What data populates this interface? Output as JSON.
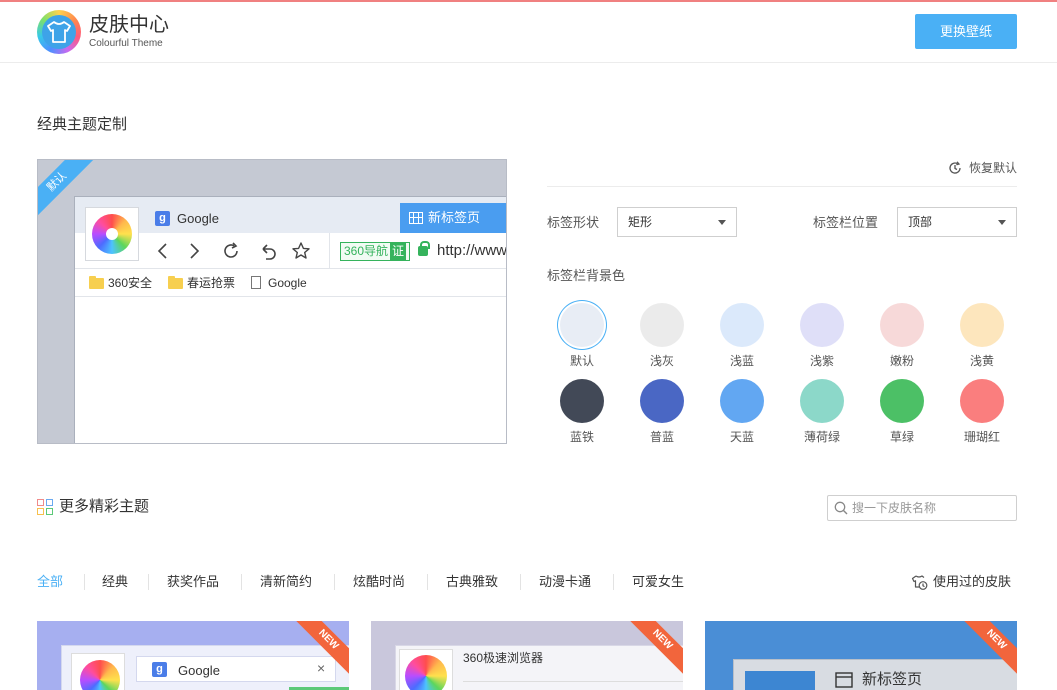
{
  "header": {
    "title": "皮肤中心",
    "subtitle": "Colourful Theme",
    "wallpaper_button": "更换壁纸"
  },
  "classic": {
    "section_title": "经典主题定制",
    "preview": {
      "ribbon": "默认",
      "tab_google": "Google",
      "tab_newtab": "新标签页",
      "badge_text": "360导航",
      "badge_cert": "证",
      "url": "http://www",
      "bookmarks": [
        "360安全",
        "春运抢票",
        "Google"
      ]
    },
    "restore_label": "恢复默认",
    "tab_shape_label": "标签形状",
    "tab_shape_value": "矩形",
    "tabbar_position_label": "标签栏位置",
    "tabbar_position_value": "顶部",
    "bg_color_label": "标签栏背景色",
    "colors": [
      {
        "name": "默认",
        "color": "#e8edf5",
        "selected": true
      },
      {
        "name": "浅灰",
        "color": "#ebebeb"
      },
      {
        "name": "浅蓝",
        "color": "#dbe9fb"
      },
      {
        "name": "浅紫",
        "color": "#dfdff8"
      },
      {
        "name": "嫩粉",
        "color": "#f7d9d9"
      },
      {
        "name": "浅黄",
        "color": "#fde6bd"
      },
      {
        "name": "蓝铁",
        "color": "#424957"
      },
      {
        "name": "普蓝",
        "color": "#4a67c4"
      },
      {
        "name": "天蓝",
        "color": "#62a7f2"
      },
      {
        "name": "薄荷绿",
        "color": "#8cd8c9"
      },
      {
        "name": "草绿",
        "color": "#4cc066"
      },
      {
        "name": "珊瑚红",
        "color": "#fa7e7e"
      }
    ]
  },
  "more": {
    "section_title": "更多精彩主题",
    "search_placeholder": "搜一下皮肤名称",
    "categories": [
      "全部",
      "经典",
      "获奖作品",
      "清新简约",
      "炫酷时尚",
      "古典雅致",
      "动漫卡通",
      "可爱女生"
    ],
    "used_skins": "使用过的皮肤",
    "cards": [
      {
        "new_badge": "NEW",
        "text": "Google",
        "bg": "#a6aff0"
      },
      {
        "new_badge": "NEW",
        "text": "360极速浏览器",
        "bg": "#c9c7dc"
      },
      {
        "new_badge": "NEW",
        "text": "新标签页",
        "bg": "#4a8ed6"
      }
    ]
  }
}
